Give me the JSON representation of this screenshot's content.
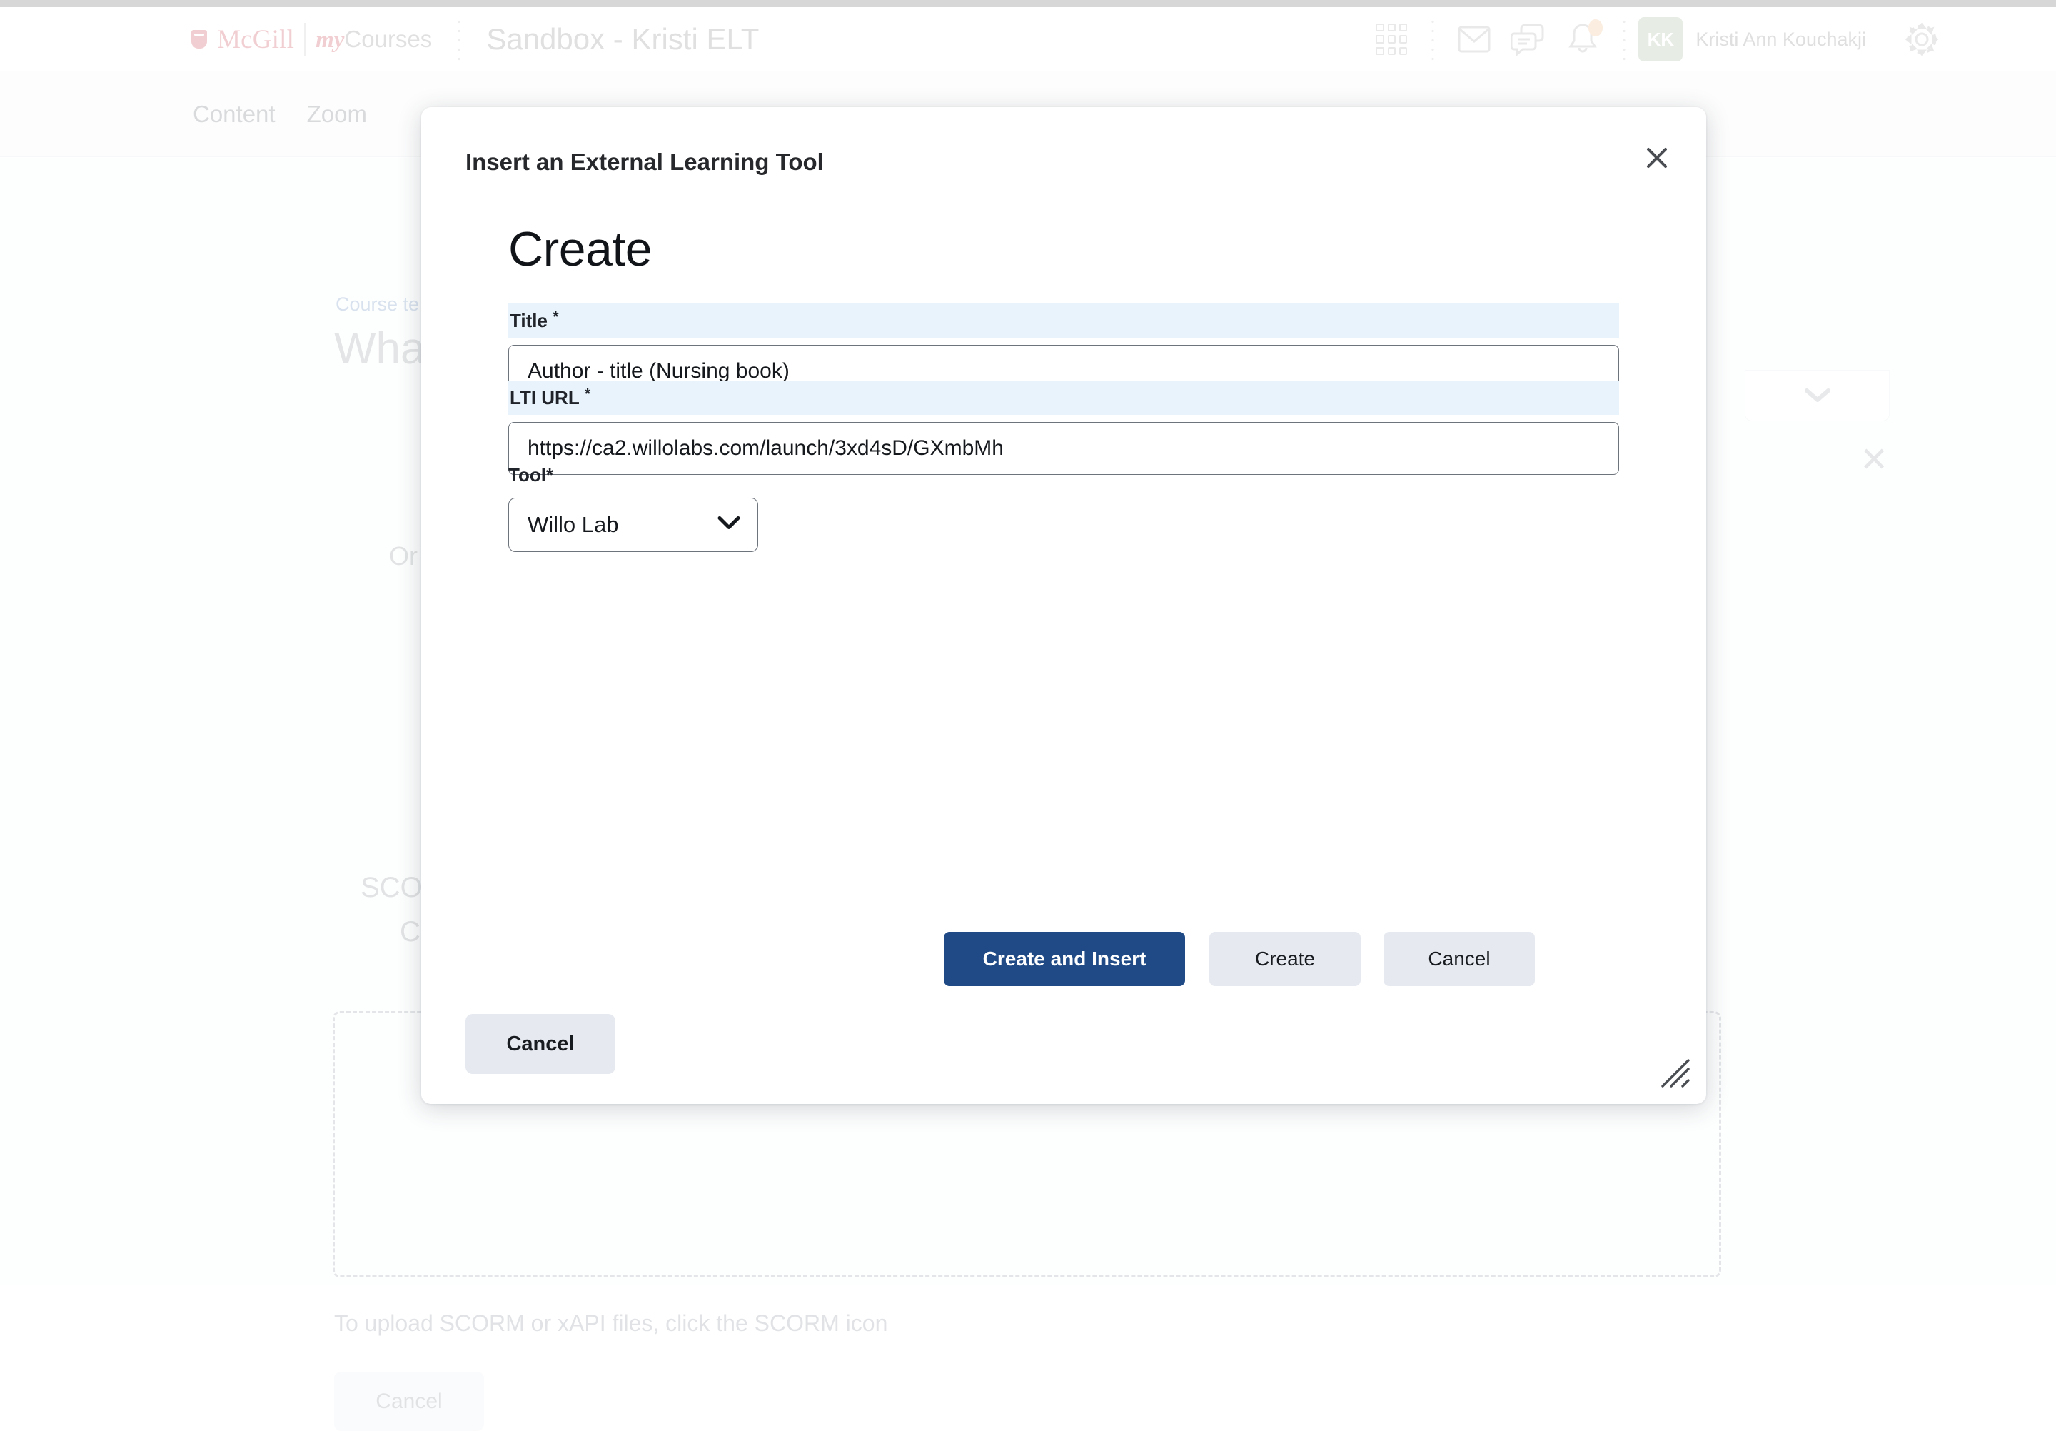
{
  "header": {
    "brand_mcgill": "McGill",
    "brand_my": "my",
    "brand_courses": "Courses",
    "course_title": "Sandbox - Kristi ELT",
    "avatar_initials": "KK",
    "user_name": "Kristi Ann Kouchakji",
    "icons": {
      "waffle": "grid-icon",
      "mail": "mail-icon",
      "chat": "chat-icon",
      "bell": "bell-icon",
      "gear": "gear-icon"
    }
  },
  "nav": {
    "tabs": [
      {
        "label": "Content"
      },
      {
        "label": "Zoom"
      }
    ]
  },
  "background": {
    "breadcrumb": "Course te",
    "page_heading": "Wha",
    "or_text": "Or",
    "scorm_line1": "SCO",
    "scorm_line2": "C",
    "upload_helper": "To upload SCORM or xAPI files, click the SCORM icon",
    "cancel_label": "Cancel"
  },
  "modal": {
    "title": "Insert an External Learning Tool",
    "close_icon": "close-icon",
    "heading": "Create",
    "fields": {
      "title": {
        "label": "Title",
        "required_mark": "*",
        "value": "Author - title (Nursing book)",
        "placeholder": ""
      },
      "lti_url": {
        "label": "LTI URL",
        "required_mark": "*",
        "value": "https://ca2.willolabs.com/launch/3xd4sD/GXmbMh",
        "placeholder": ""
      },
      "tool": {
        "label": "Tool",
        "required_mark": "*",
        "selected": "Willo Lab",
        "options": [
          "Willo Lab"
        ],
        "chevron_icon": "chevron-down-icon"
      }
    },
    "buttons": {
      "create_and_insert": "Create and Insert",
      "create": "Create",
      "cancel": "Cancel"
    },
    "footer_cancel": "Cancel",
    "resize_icon": "resize-grip-icon"
  },
  "colors": {
    "primary_button": "#1f4a85",
    "secondary_button": "#e6eaf0",
    "field_label_bg": "#e9f3fb",
    "brand_red": "#d4606a",
    "avatar_bg": "#b3c7ac",
    "notification_dot": "#f3c49a"
  }
}
